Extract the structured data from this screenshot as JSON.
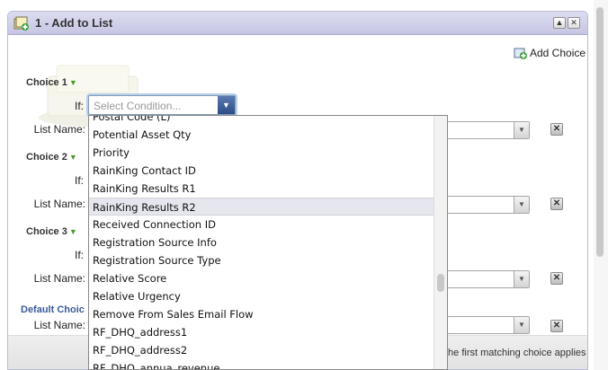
{
  "panel": {
    "title": "1 - Add to List",
    "minimize_symbol": "▲",
    "close_symbol": "✕",
    "add_choice_label": "Add Choice"
  },
  "choices": [
    {
      "label": "Choice 1",
      "if_label": "If:",
      "list_name_label": "List Name:"
    },
    {
      "label": "Choice 2",
      "if_label": "If:",
      "list_name_label": "List Name:"
    },
    {
      "label": "Choice 3",
      "if_label": "If:",
      "list_name_label": "List Name:"
    }
  ],
  "default_choice": {
    "label": "Default Choic",
    "list_name_label": "List Name:"
  },
  "condition_select": {
    "placeholder": "Select Condition..."
  },
  "dropdown": {
    "items": [
      "Postal Code (L)",
      "Potential Asset Qty",
      "Priority",
      "RainKing Contact ID",
      "RainKing Results R1",
      "RainKing Results R2",
      "Received Connection ID",
      "Registration Source Info",
      "Registration Source Type",
      "Relative Score",
      "Relative Urgency",
      "Remove From Sales Email Flow",
      "RF_DHQ_address1",
      "RF_DHQ_address2",
      "RF_DHQ_annua_revenue"
    ],
    "highlighted": "RainKing Results R2"
  },
  "footer_note": "the first matching choice applies",
  "icons": {
    "header": "list-add-icon",
    "add_choice": "add-choice-icon",
    "delete": "delete-icon",
    "expand": "triangle-down-icon"
  },
  "colors": {
    "header_bg": "#c6c6e4",
    "highlight_row": "#e6e6ee",
    "default_label": "#3a5a9a",
    "accent_green": "#4a9a2a"
  }
}
